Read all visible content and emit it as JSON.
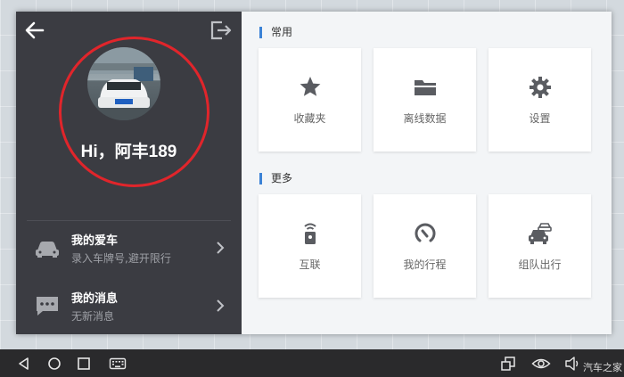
{
  "profile": {
    "greeting": "Hi，阿丰189"
  },
  "menu": [
    {
      "title": "我的爱车",
      "subtitle": "录入车牌号,避开限行"
    },
    {
      "title": "我的消息",
      "subtitle": "无新消息"
    }
  ],
  "sections": {
    "common_label": "常用",
    "more_label": "更多"
  },
  "tiles_common": [
    {
      "label": "收藏夹",
      "icon": "star-icon"
    },
    {
      "label": "离线数据",
      "icon": "folder-icon"
    },
    {
      "label": "设置",
      "icon": "gear-icon"
    }
  ],
  "tiles_more": [
    {
      "label": "互联",
      "icon": "remote-icon"
    },
    {
      "label": "我的行程",
      "icon": "trip-icon"
    },
    {
      "label": "组队出行",
      "icon": "team-car-icon"
    }
  ],
  "watermark": "汽车之家",
  "colors": {
    "left_panel": "#3b3c42",
    "accent": "#3b82d6",
    "ring": "#e0252b"
  }
}
